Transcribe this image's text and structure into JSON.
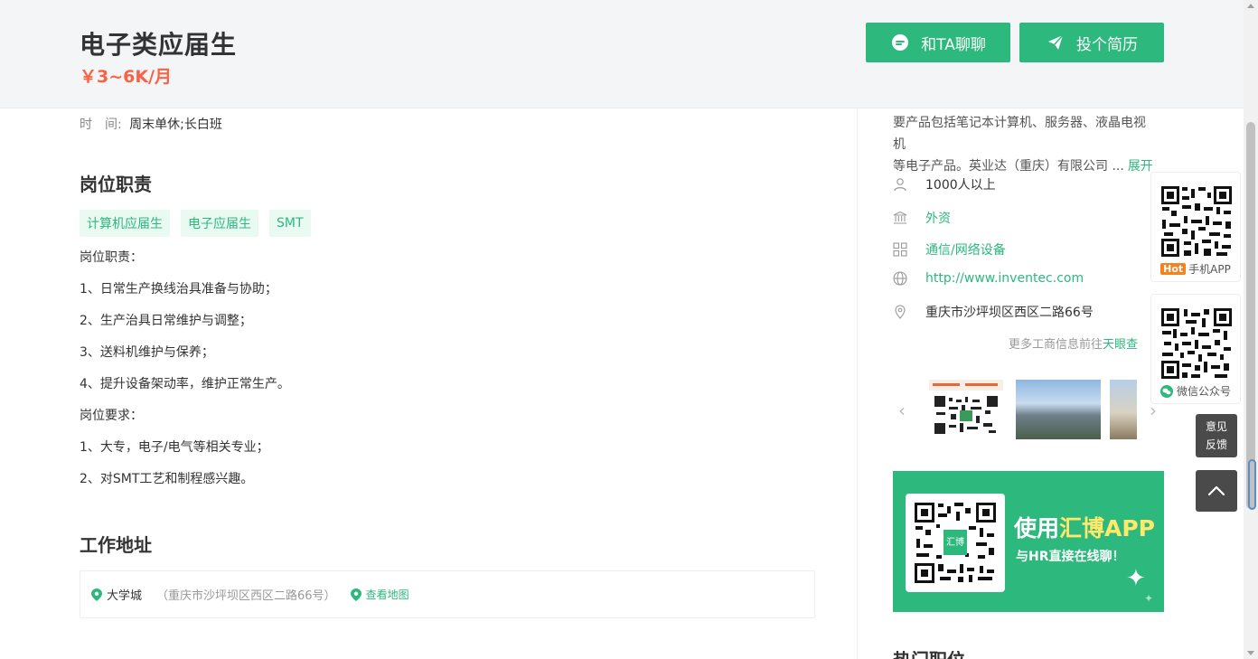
{
  "header": {
    "job_title": "电子类应届生",
    "salary": "￥3~6K/月",
    "chat_button": "和TA聊聊",
    "apply_button": "投个简历"
  },
  "job": {
    "time_label": "时　间:",
    "time_value": "周末单休;长白班",
    "duty_title": "岗位职责",
    "tags": [
      "计算机应届生",
      "电子应届生",
      "SMT"
    ],
    "description_lines": [
      "岗位职责：",
      "1、日常生产换线治具准备与协助；",
      "2、生产治具日常维护与调整；",
      "3、送料机维护与保养；",
      "4、提升设备架动率，维护正常生产。",
      "岗位要求：",
      "1、大专，电子/电气等相关专业；",
      "2、对SMT工艺和制程感兴趣。"
    ],
    "address_title": "工作地址",
    "address_area": "大学城",
    "address_detail": "（重庆市沙坪坝区西区二路66号）",
    "map_link": "查看地图"
  },
  "company": {
    "intro_line1": "要产品包括笔记本计算机、服务器、液晶电视机",
    "intro_line2": "等电子产品。英业达（重庆）有限公司 ...",
    "expand": "展开",
    "size": "1000人以上",
    "nature": "外资",
    "industry": "通信/网络设备",
    "website": "http://www.inventec.com",
    "address": "重庆市沙坪坝区西区二路66号",
    "more_info_prefix": "更多工商信息前往",
    "more_info_link": "天眼查",
    "banner_headline_pre": "使用",
    "banner_headline_hl": "汇博APP",
    "banner_sub": "与HR直接在线聊！",
    "banner_logo": "汇博",
    "section_title_cut": "热门职位"
  },
  "side": {
    "app_hot": "Hot",
    "app_label": "手机APP",
    "wechat_label": "微信公众号",
    "feedback_line1": "意见",
    "feedback_line2": "反馈"
  },
  "colors": {
    "accent": "#2db87d",
    "salary": "#fb6244",
    "tag_bg": "#e9faf2"
  }
}
